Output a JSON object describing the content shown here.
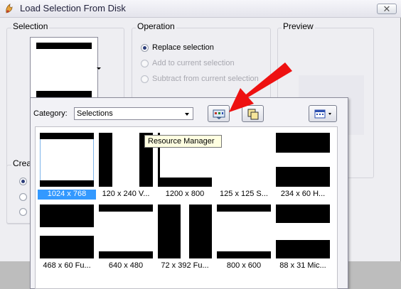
{
  "window": {
    "title": "Load Selection From Disk"
  },
  "selection_group": {
    "label": "Selection"
  },
  "operation_group": {
    "label": "Operation",
    "options": [
      {
        "label": "Replace selection",
        "checked": true,
        "enabled": true
      },
      {
        "label": "Add to current selection",
        "checked": false,
        "enabled": false
      },
      {
        "label": "Subtract from current selection",
        "checked": false,
        "enabled": false
      }
    ]
  },
  "preview_group": {
    "label": "Preview"
  },
  "create_group": {
    "label": "Crea"
  },
  "browser": {
    "category_label": "Category:",
    "category_value": "Selections",
    "tooltip": "Resource Manager"
  },
  "thumbnails": [
    {
      "caption": "1024 x 768",
      "selected": true
    },
    {
      "caption": "120 x 240 V...",
      "selected": false
    },
    {
      "caption": "1200 x 800",
      "selected": false
    },
    {
      "caption": "125 x 125 S...",
      "selected": false
    },
    {
      "caption": "234 x 60 H...",
      "selected": false
    },
    {
      "caption": "468 x 60 Fu...",
      "selected": false
    },
    {
      "caption": "640 x 480",
      "selected": false
    },
    {
      "caption": "72 x 392 Fu...",
      "selected": false
    },
    {
      "caption": "800 x 600",
      "selected": false
    },
    {
      "caption": "88 x 31 Mic...",
      "selected": false
    }
  ],
  "colors": {
    "highlight": "#3399ff",
    "arrow": "#ee1111",
    "tooltip_bg": "#ffffe1"
  }
}
